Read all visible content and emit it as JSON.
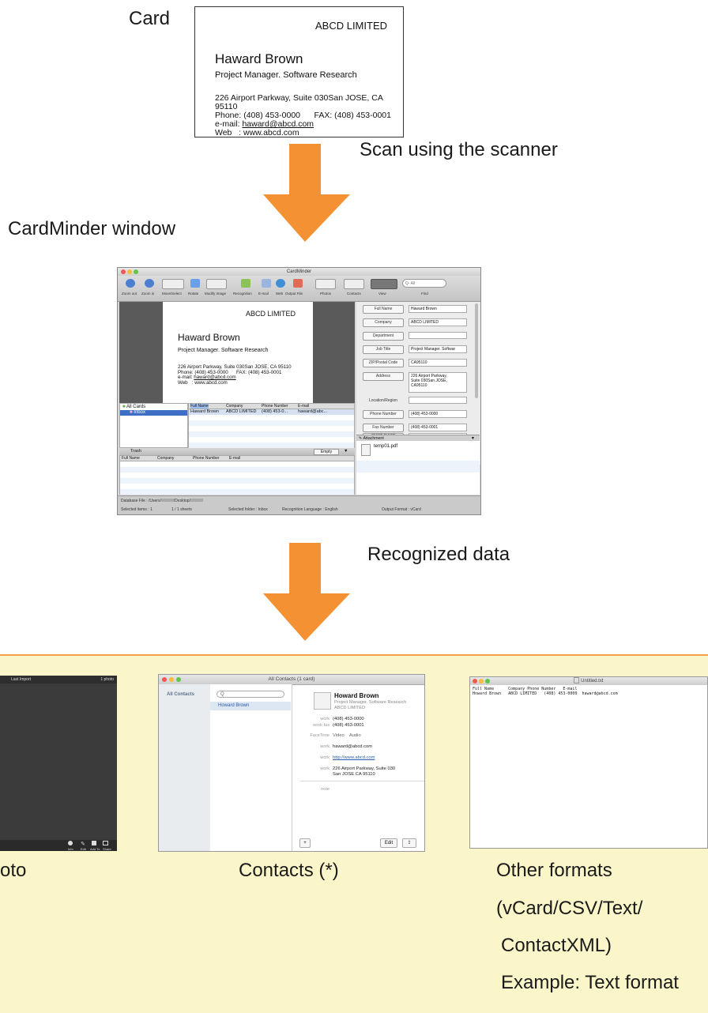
{
  "labels": {
    "card": "Card",
    "scan": "Scan using the scanner",
    "cardminder_window": "CardMinder window",
    "recognized": "Recognized data",
    "photo": "oto",
    "contacts": "Contacts (*)",
    "other1": "Other formats",
    "other2": "(vCard/CSV/Text/",
    "other3": "ContactXML)",
    "other4": "Example: Text format"
  },
  "card": {
    "company": "ABCD LIMITED",
    "name": "Haward Brown",
    "title": "Project Manager. Software Research",
    "addr1": "226 Airport Parkway, Suite 030San JOSE, CA 95110",
    "addr2": "Phone: (408) 453-0000      FAX: (408) 453-0001",
    "addr3_label": "e-mail: ",
    "addr3_link": "haward@abcd.com",
    "addr4": "Web   : www.abcd.com"
  },
  "cardminder": {
    "title": "CardMinder",
    "toolbar": [
      "Zoom out",
      "Zoom in",
      "Move/Select",
      "Rotate",
      "Modify Image",
      "Recognition",
      "E-mail",
      "Web",
      "Output File",
      "Photos",
      "Contacts",
      "View",
      "Find"
    ],
    "search_placeholder": "Q- All",
    "fields": [
      {
        "label": "Full Name",
        "value": "Haward Brown"
      },
      {
        "label": "Company",
        "value": "ABCD LIMITED"
      },
      {
        "label": "Department",
        "value": ""
      },
      {
        "label": "Job Title",
        "value": "Project Manager. Softwar"
      },
      {
        "label": "ZIP/Postal Code",
        "value": "CA95110"
      },
      {
        "label": "Address",
        "value": "226 Airport Parkway,\nSuite 030San JOSE,\nCA95110"
      },
      {
        "label": "Location/Region",
        "value": ""
      },
      {
        "label": "Phone Number",
        "value": "(408) 453-0000"
      },
      {
        "label": "Fax Number",
        "value": "(408) 453-0001"
      },
      {
        "label": "Mobile Phone",
        "value": ""
      }
    ],
    "attachment_header": "Attachment",
    "attachment_file": "temp01.pdf",
    "folders": [
      "All Cards",
      "Inbox"
    ],
    "list_headers": [
      "Full Name",
      "Company",
      "Phone Number",
      "E-mail"
    ],
    "list_row": [
      "Haward Brown",
      "ABCD LIMITED",
      "(408) 453-0...",
      "haward@abc..."
    ],
    "trash_label": "Trash",
    "empty_button": "Empty",
    "trash_headers": [
      "Full Name",
      "Company",
      "Phone Number",
      "E-mail"
    ],
    "status_db": "Database File : /Users/",
    "status_db2": "/Desktop/",
    "status": [
      "Selected items : 1",
      "1 / 1 sheets",
      "Selected folder : Inbox",
      "Recognition Language : English",
      "Output Format : vCard"
    ]
  },
  "contacts_window": {
    "title": "All Contacts (1 card)",
    "sidebar": "All Contacts",
    "search": "Q",
    "selected": "Howard Brown",
    "name": "Howard Brown",
    "job": "Project Manager. Software Research",
    "company": "ABCD LIMITED",
    "rows": [
      {
        "label": "work",
        "value": "(408) 453-0000"
      },
      {
        "label": "work fax",
        "value": "(408) 453-0001"
      },
      {
        "label": "FaceTime",
        "value": "Video    Audio"
      },
      {
        "label": "work",
        "value": "haward@abcd.com"
      },
      {
        "label": "work",
        "value": "http://www.abcd.com"
      },
      {
        "label": "work",
        "value": "226 Airport Parkway, Suite 030"
      },
      {
        "label": "",
        "value": "San JOSE CA 95110"
      },
      {
        "label": "note",
        "value": ""
      }
    ],
    "add_button": "+",
    "edit_button": "Edit"
  },
  "text_window": {
    "title": "Untitled.txt",
    "line1": "Full Name      Company Phone Number   E-mail",
    "line2": "Howard Brown   ABCD LIMITED   (408) 453-0000  haward@abcd.com"
  },
  "photos_window": {
    "header": "Last Import",
    "count": "1 photo",
    "footer": [
      "Info",
      "Edit",
      "Add To",
      "Share"
    ]
  },
  "colors": {
    "arrow": "#f39133",
    "band": "#fbf6c9",
    "band_border": "#f5a04a",
    "select": "#3d6fc4"
  }
}
